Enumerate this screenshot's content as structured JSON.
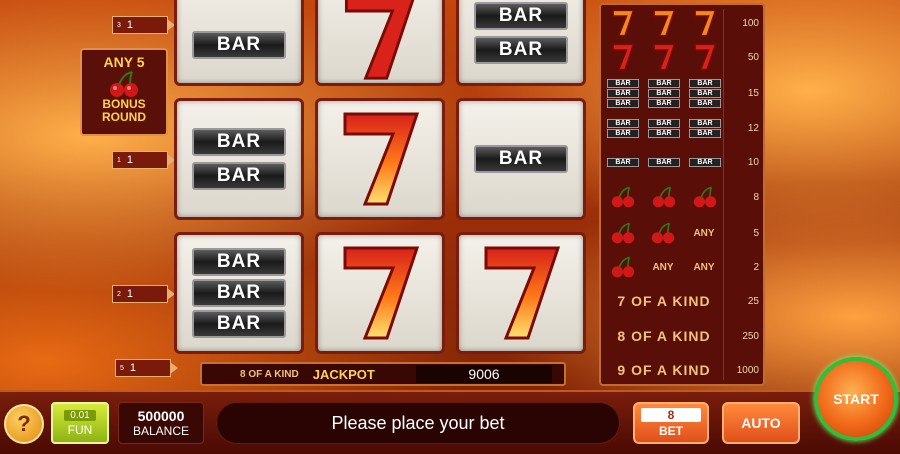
{
  "bonus": {
    "any_label": "ANY 5",
    "round_label": "BONUS\nROUND"
  },
  "lines": [
    {
      "num": "3",
      "value": "1"
    },
    {
      "num": "1",
      "value": "1"
    },
    {
      "num": "2",
      "value": "1"
    },
    {
      "num": "5",
      "value": "1"
    }
  ],
  "reels": {
    "bar_text": "BAR"
  },
  "paytable": [
    {
      "symbols": "seven x3",
      "payout": "100"
    },
    {
      "symbols": "seven x3 red",
      "payout": "50"
    },
    {
      "symbols": "triple bar x3",
      "payout": "15"
    },
    {
      "symbols": "double bar x3",
      "payout": "12"
    },
    {
      "symbols": "single bar x3",
      "payout": "10"
    },
    {
      "symbols": "cherry x3",
      "payout": "8"
    },
    {
      "symbols": "cherry x2 any",
      "payout": "5",
      "any": "ANY"
    },
    {
      "symbols": "cherry any any",
      "payout": "2",
      "any": "ANY"
    },
    {
      "label": "7 OF A KIND",
      "payout": "25"
    },
    {
      "label": "8 OF A KIND",
      "payout": "250"
    },
    {
      "label": "9 OF A KIND",
      "payout": "1000"
    }
  ],
  "jackpot": {
    "kind_label": "8 OF A KIND",
    "label": "JACKPOT",
    "value": "9006"
  },
  "bottom": {
    "help": "?",
    "fun_value": "0.01",
    "fun_label": "FUN",
    "balance_value": "500000",
    "balance_label": "BALANCE",
    "message": "Please place your bet",
    "bet_value": "8",
    "bet_label": "BET",
    "auto_label": "AUTO",
    "start_label": "START"
  },
  "colors": {
    "accent_green": "#2fbf3a",
    "orange_button": "#e0501a",
    "gold_text": "#f2c27a"
  }
}
